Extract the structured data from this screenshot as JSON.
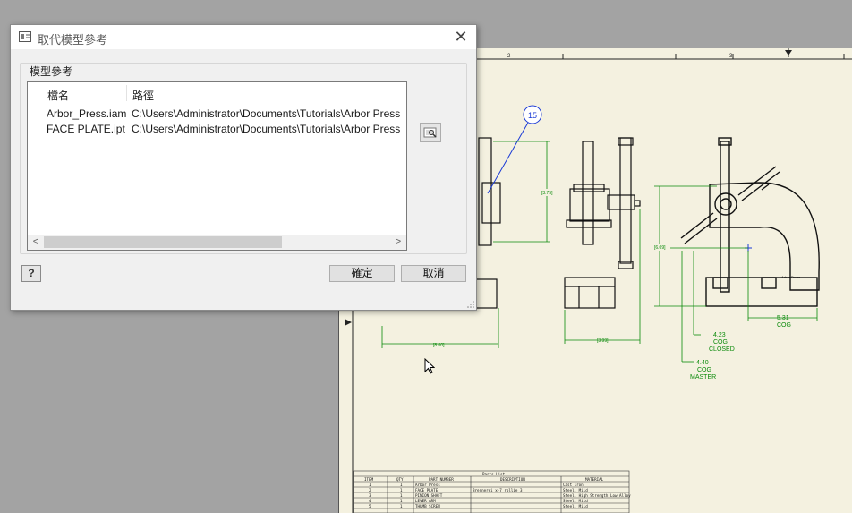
{
  "dialog": {
    "title": "取代模型參考",
    "close_glyph": "✕",
    "group_label": "模型參考",
    "columns": [
      "檔名",
      "路徑"
    ],
    "rows": [
      {
        "name": "Arbor_Press.iam",
        "path": "C:\\Users\\Administrator\\Documents\\Tutorials\\Arbor Press"
      },
      {
        "name": "FACE PLATE.ipt",
        "path": "C:\\Users\\Administrator\\Documents\\Tutorials\\Arbor Press"
      }
    ],
    "scroll_left": "<",
    "scroll_right": ">",
    "help_label": "?",
    "ok_label": "確定",
    "cancel_label": "取消"
  },
  "drawing": {
    "balloon": "15",
    "cog_closed_value": "4.23",
    "cog_closed_label1": "COG",
    "cog_closed_label2": "CLOSED",
    "cog_master_value": "4.40",
    "cog_master_label1": "COG",
    "cog_master_label2": "MASTER",
    "cog_value": "5.31",
    "cog_label": "COG",
    "ruler_numbers": [
      "2",
      "3"
    ],
    "parts_list": {
      "title": "Parts List",
      "headers": [
        "ITEM",
        "QTY",
        "PART NUMBER",
        "DESCRIPTION",
        "MATERIAL"
      ],
      "rows": [
        [
          "1",
          "1",
          "Arbor Press",
          "",
          "Cast Iron"
        ],
        [
          "2",
          "1",
          "FACE PLATE",
          "Brennerei x-7 rollie 3",
          "Steel, Mild"
        ],
        [
          "3",
          "1",
          "PINION SHAFT",
          "",
          "Steel, High Strength Low Alloy"
        ],
        [
          "4",
          "1",
          "LEVER ARM",
          "",
          "Steel, Mild"
        ],
        [
          "5",
          "1",
          "THUMB SCREW",
          "",
          "Steel, Mild"
        ]
      ]
    }
  },
  "colors": {
    "sheet": "#f4f1e0",
    "dimension": "#0a8a0a",
    "balloon": "#1a3ad6",
    "desktop": "#a3a3a3"
  }
}
